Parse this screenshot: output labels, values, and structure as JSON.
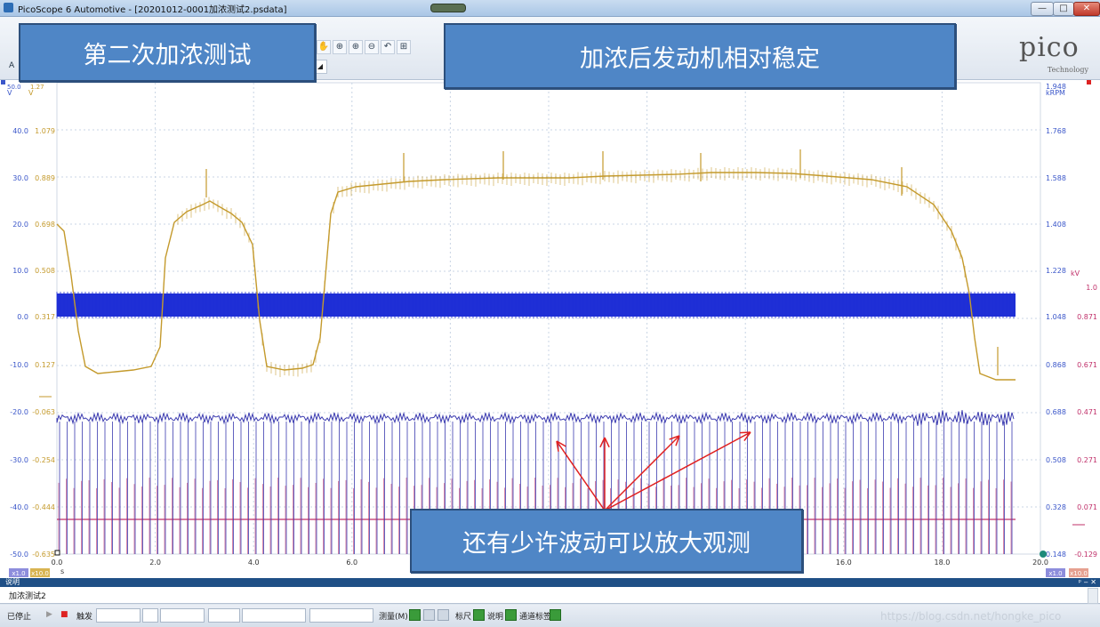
{
  "window": {
    "title": "PicoScope 6 Automotive - [20201012-0001加浓测试2.psdata]",
    "min_glyph": "—",
    "max_glyph": "□",
    "close_glyph": "✕"
  },
  "toolbar": {
    "tab_letter": "A",
    "icons": [
      "hand-tool",
      "zoom-in",
      "zoom-in-2",
      "zoom-out",
      "undo-zoom",
      "zoom-to-fit"
    ],
    "icon_glyphs": [
      "✋",
      "⊕",
      "⊕",
      "⊖",
      "↶",
      "⊞"
    ],
    "dropdown_glyph": "◢"
  },
  "annotations": {
    "callout1": "第二次加浓测试",
    "callout2": "加浓后发动机相对稳定",
    "callout3": "还有少许波动可以放大观测"
  },
  "logo": {
    "word": "pico",
    "sub": "Technology"
  },
  "scope": {
    "colors": {
      "ch_a": "#1f2fd6",
      "ch_b": "#c49a2c",
      "ch_c": "#3b3bb0",
      "ch_d": "#c0306a",
      "grid": "#c8d4e4",
      "arrow": "#e02020",
      "axis_rpm": "#3a56c9",
      "axis_kv": "#c0306a"
    },
    "left_units": [
      "V",
      "V"
    ],
    "right_units": [
      "kRPM",
      "kV"
    ],
    "left_ticks_a": [
      "40.0",
      "30.0",
      "20.0",
      "10.0",
      "0.0",
      "-10.0",
      "-20.0",
      "-30.0",
      "-40.0",
      "-50.0"
    ],
    "left_ticks_b": [
      "1.079",
      "0.889",
      "0.698",
      "0.508",
      "0.317",
      "0.127",
      "-0.063",
      "-0.254",
      "-0.444",
      "-0.635"
    ],
    "right_ticks_rpm": [
      "1.948",
      "1.768",
      "1.588",
      "1.408",
      "1.228",
      "1.048",
      "0.868",
      "0.688",
      "0.508",
      "0.328",
      "0.148"
    ],
    "right_ticks_kv": [
      "1.0",
      "0.871",
      "0.671",
      "0.471",
      "0.271",
      "0.071",
      "-0.129"
    ],
    "x_ticks": [
      "0.0",
      "2.0",
      "4.0",
      "6.0",
      "16.0",
      "18.0",
      "20.0"
    ],
    "x_unit": "s",
    "top_left_label": "50.0",
    "top_left_label2": "1.27",
    "zoom_badges_left": [
      "x1.0",
      "x10.0"
    ],
    "zoom_badges_right": [
      "x1.0",
      "x10.0"
    ]
  },
  "description": {
    "header": "说明",
    "text": "加浓测试2",
    "pin_glyph": "ᵖ",
    "collapse_glyph": "‒",
    "close_glyph": "✕"
  },
  "status": {
    "stopped": "已停止",
    "trigger": "触发",
    "measure": "测量(M)",
    "ruler": "标尺",
    "notes": "说明",
    "channel_labels": "通道标签",
    "watermark": "https://blog.csdn.net/hongke_pico"
  }
}
